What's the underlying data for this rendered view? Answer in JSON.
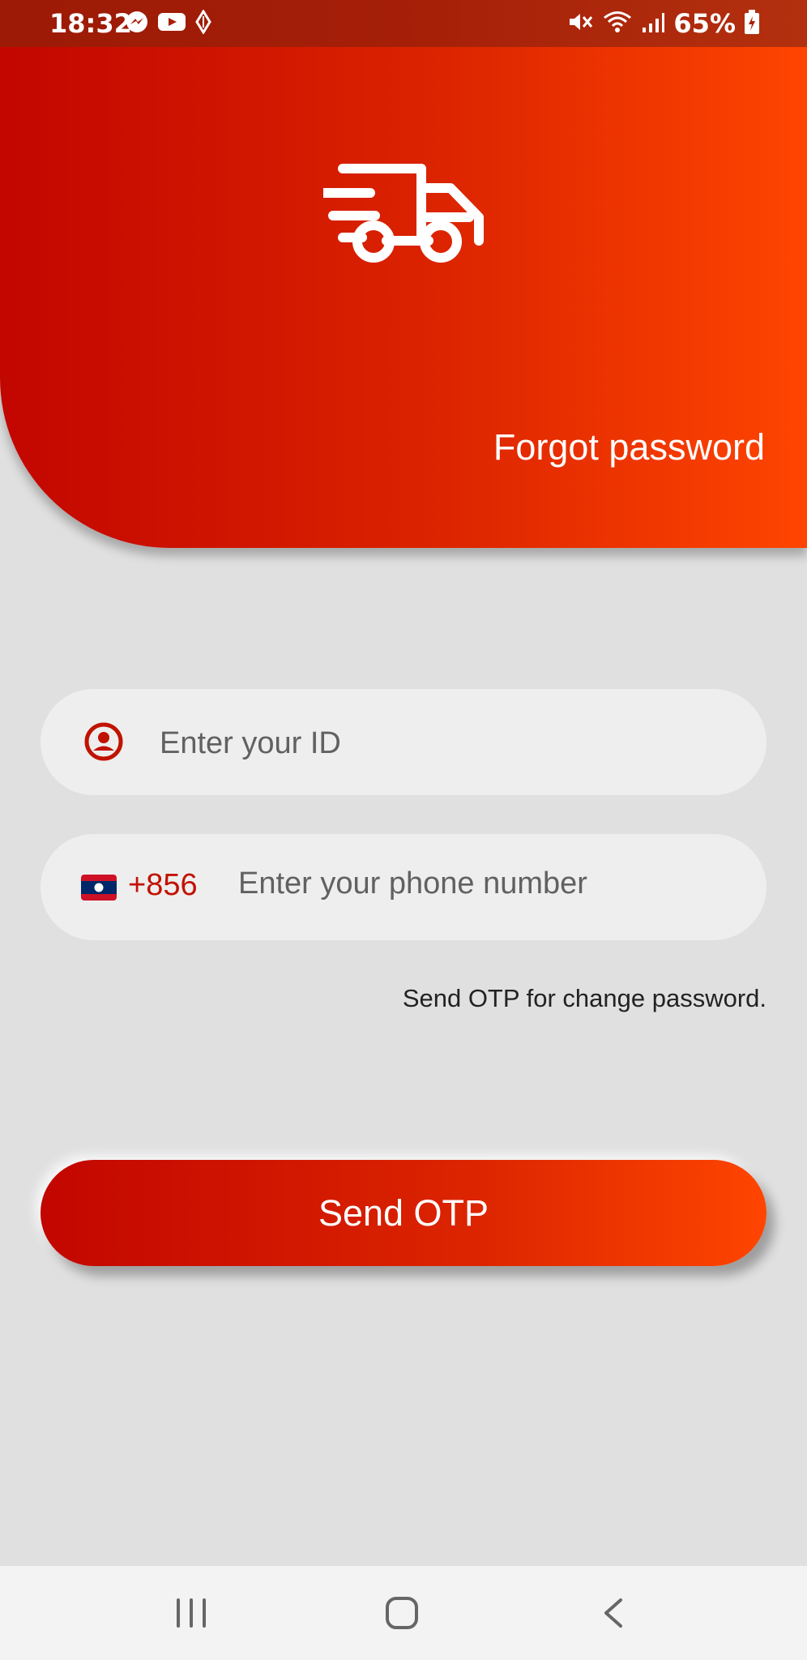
{
  "status_bar": {
    "time": "18:32",
    "battery": "65%"
  },
  "header": {
    "title": "Forgot password"
  },
  "form": {
    "id_field": {
      "placeholder": "Enter your ID",
      "icon": "user-circle-icon"
    },
    "phone_field": {
      "country_code": "+856",
      "placeholder": "Enter your phone number",
      "flag_icon": "laos-flag-icon"
    },
    "helper_text": "Send OTP for change password."
  },
  "actions": {
    "send_otp_label": "Send OTP"
  },
  "colors": {
    "brand_red": "#c20600",
    "brand_orange": "#ff4500",
    "background": "#e0e0e0"
  }
}
